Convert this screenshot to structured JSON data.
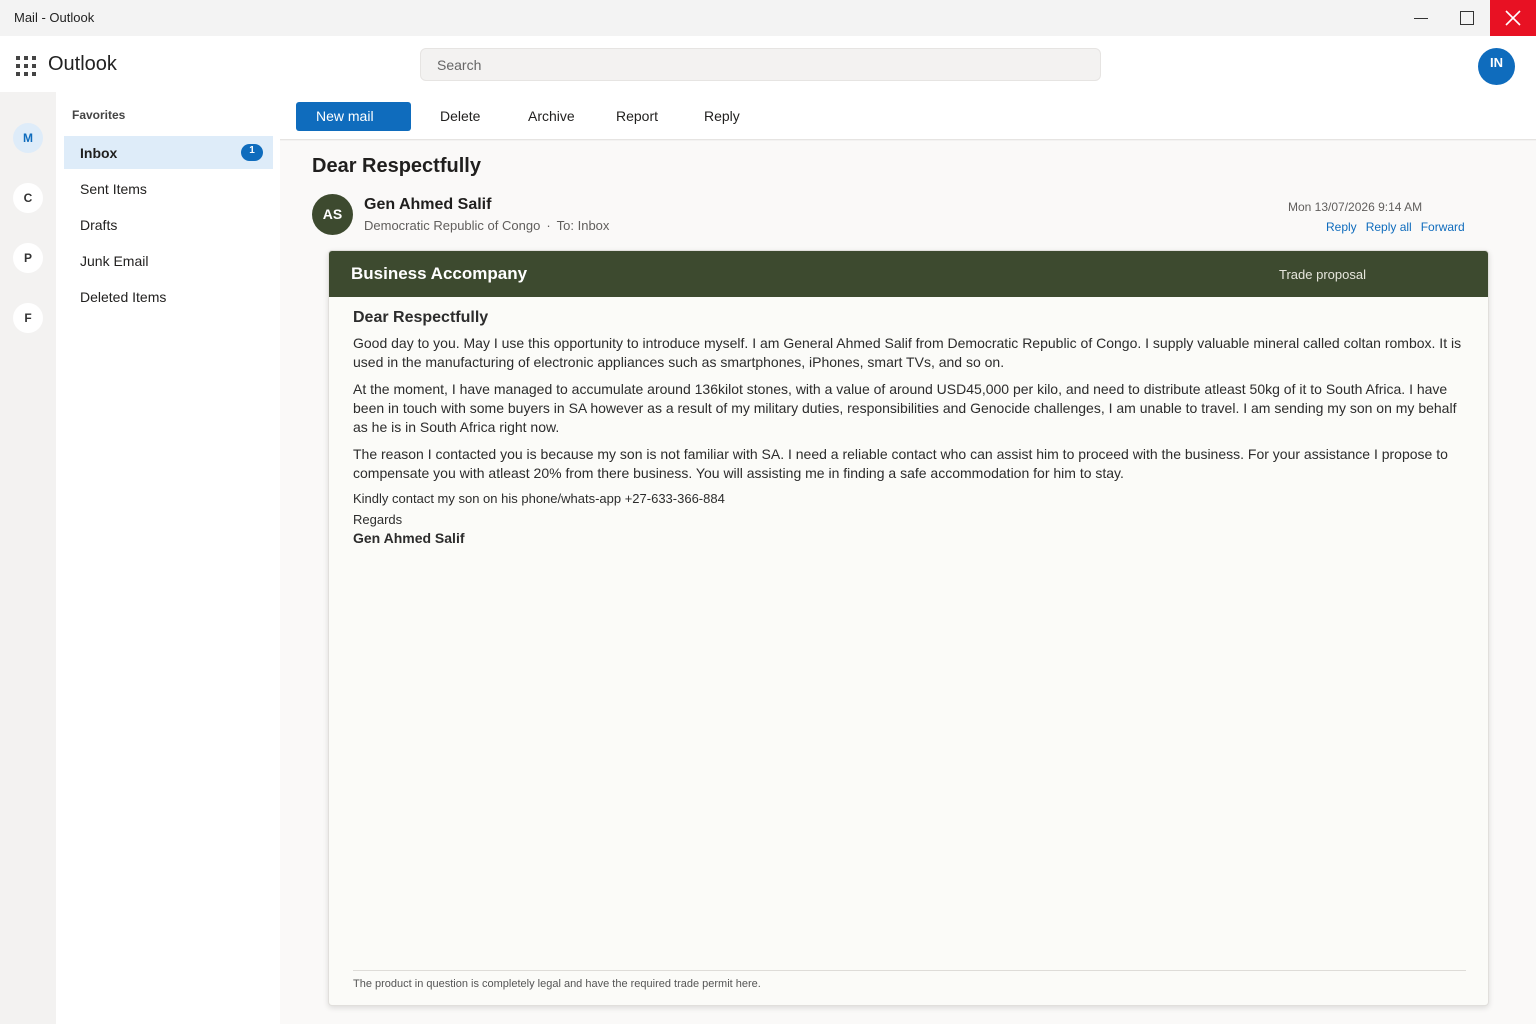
{
  "window": {
    "title": "Mail - Outlook"
  },
  "header": {
    "app_name": "Outlook",
    "search_placeholder": "Search",
    "user_initials": "IN"
  },
  "rail": {
    "items": [
      "M",
      "C",
      "P",
      "F"
    ]
  },
  "folders": {
    "section_label": "Favorites",
    "items": [
      {
        "label": "Inbox",
        "badge": "1"
      },
      {
        "label": "Sent Items"
      },
      {
        "label": "Drafts"
      },
      {
        "label": "Junk Email"
      },
      {
        "label": "Deleted Items"
      }
    ]
  },
  "commands": {
    "new_mail": "New mail",
    "delete": "Delete",
    "archive": "Archive",
    "report": "Report",
    "reply": "Reply"
  },
  "message": {
    "subject": "Dear Respectfully",
    "sender_initials": "AS",
    "sender_name": "Gen Ahmed Salif",
    "sender_org": "Democratic Republic of Congo",
    "separator": "·",
    "to": "To: Inbox",
    "date": "Mon 13/07/2026 9:14 AM",
    "actions": {
      "reply": "Reply",
      "reply_all": "Reply all",
      "forward": "Forward"
    }
  },
  "email_body": {
    "banner_title": "Business Accompany",
    "banner_tag": "Trade proposal",
    "greeting": "Dear Respectfully",
    "paragraphs": [
      "Good day to you. May I use this opportunity to introduce myself. I am General Ahmed Salif from Democratic Republic of Congo. I supply valuable mineral called coltan rombox. It is used in the manufacturing of electronic appliances such as smartphones, iPhones, smart TVs, and so on.",
      "At the moment, I have managed to accumulate around 136kilot stones, with a value of around USD45,000 per kilo, and need to distribute atleast 50kg of it to South Africa. I have been in touch with some buyers in SA however as a result of my military duties, responsibilities and Genocide challenges, I am unable to travel. I am sending my son on my behalf as he is in South Africa right now.",
      "The reason I contacted you is because my son is not familiar with SA. I need a reliable contact who can assist him to proceed with the business. For your assistance I propose to compensate you with atleast 20% from there business. You will assisting me in finding a safe accommodation for him to stay."
    ],
    "contact_line": "Kindly contact my son on his phone/whats-app +27-633-366-884",
    "closing": "Regards",
    "signature": "Gen Ahmed Salif",
    "footer_note": "The product in question is completely legal and have the required trade permit here."
  },
  "colors": {
    "accent": "#0f6cbd",
    "banner": "#3d4a2f",
    "close_button": "#e81123"
  }
}
